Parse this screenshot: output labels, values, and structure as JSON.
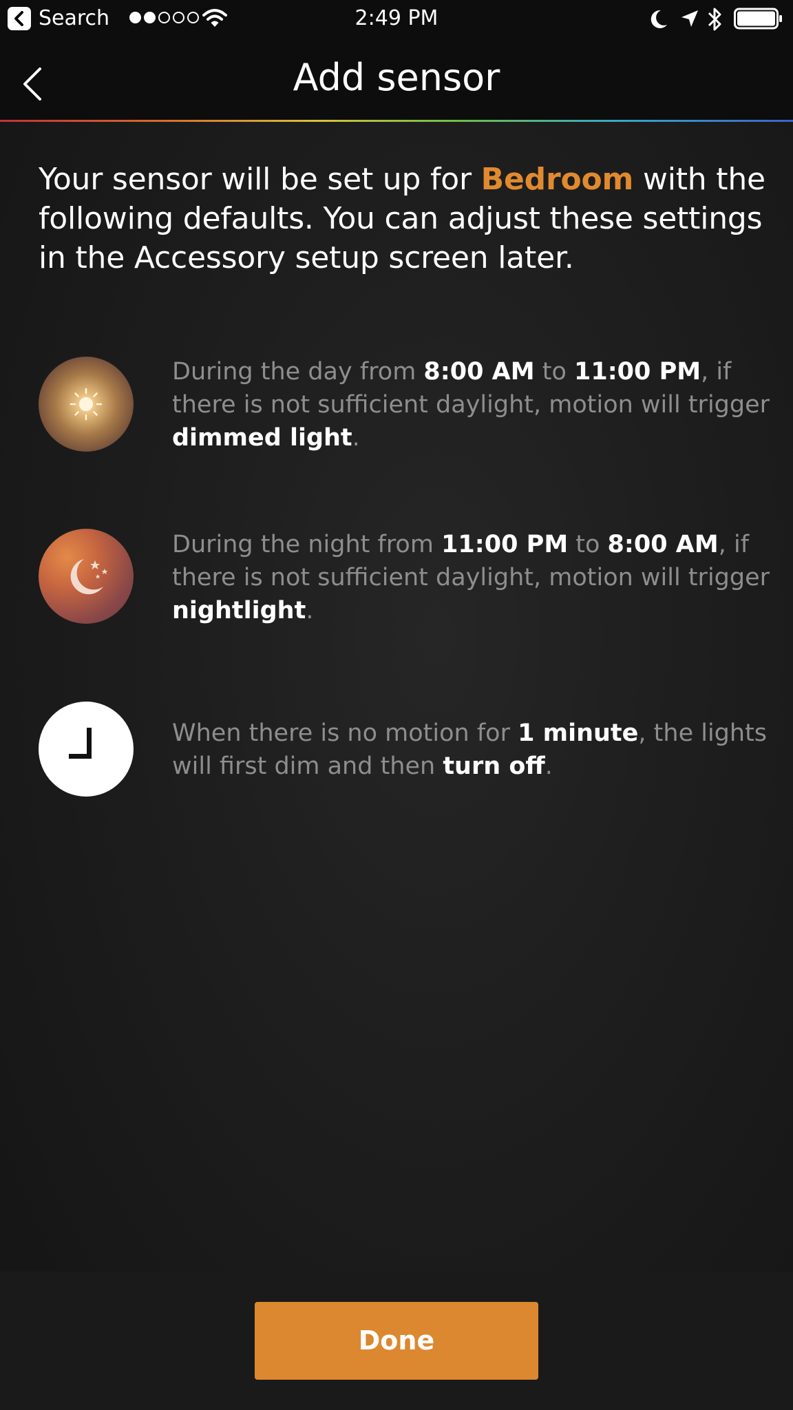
{
  "status_bar": {
    "back_app_label": "Search",
    "signal_filled": 2,
    "signal_total": 5,
    "time": "2:49 PM"
  },
  "nav": {
    "title": "Add sensor"
  },
  "intro": {
    "prefix": "Your sensor will be set up for ",
    "room": "Bedroom",
    "suffix": " with the following defaults. You can adjust these settings in the Accessory setup screen later.",
    "accent_color": "#e08a30"
  },
  "rows": {
    "day": {
      "icon": "sun-icon",
      "t1": "During the day from ",
      "start": "8:00 AM",
      "t2": " to ",
      "end": "11:00 PM",
      "t3": ", if there is not sufficient daylight, motion will trigger ",
      "scene": "dimmed light",
      "t4": "."
    },
    "night": {
      "icon": "moon-stars-icon",
      "t1": "During the night from ",
      "start": "11:00 PM",
      "t2": " to ",
      "end": "8:00 AM",
      "t3": ", if there is not sufficient daylight, motion will trigger ",
      "scene": "nightlight",
      "t4": "."
    },
    "timeout": {
      "icon": "clock-icon",
      "t1": "When there is no motion for ",
      "duration": "1 minute",
      "t2": ", the lights will first dim and then ",
      "action": "turn off",
      "t3": "."
    }
  },
  "footer": {
    "done_label": "Done",
    "button_color": "#dc8830"
  }
}
